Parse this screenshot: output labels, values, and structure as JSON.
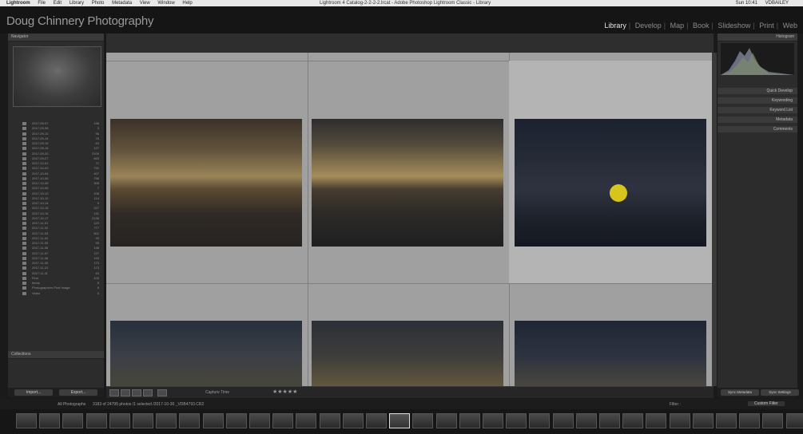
{
  "menubar": {
    "items": [
      "Lightroom",
      "File",
      "Edit",
      "Library",
      "Photo",
      "Metadata",
      "View",
      "Window",
      "Help"
    ],
    "window_title": "Lightroom 4 Catalog-2-2-2-2.lrcat - Adobe Photoshop Lightroom Classic - Library",
    "clock": "Sun 10:41",
    "user": "VDBAILEY"
  },
  "identity": {
    "plate": "Doug Chinnery Photography",
    "modules": [
      "Library",
      "Develop",
      "Map",
      "Book",
      "Slideshow",
      "Print",
      "Web"
    ],
    "active_module": "Library"
  },
  "left_panel": {
    "navigator_label": "Navigator",
    "folders": [
      {
        "name": "2017-09-07",
        "count": "198"
      },
      {
        "name": "2017-09-08",
        "count": "3"
      },
      {
        "name": "2017-09-10",
        "count": "96"
      },
      {
        "name": "2017-09-14",
        "count": "75"
      },
      {
        "name": "2017-09-15",
        "count": "63"
      },
      {
        "name": "2017-09-16",
        "count": "127"
      },
      {
        "name": "2017-09-20",
        "count": "2109"
      },
      {
        "name": "2017-09-27",
        "count": "663"
      },
      {
        "name": "2017-10-01",
        "count": "71"
      },
      {
        "name": "2017-10-03",
        "count": "791"
      },
      {
        "name": "2017-10-04",
        "count": "407"
      },
      {
        "name": "2017-10-05",
        "count": "796"
      },
      {
        "name": "2017-10-06",
        "count": "308"
      },
      {
        "name": "2017-10-08",
        "count": "7"
      },
      {
        "name": "2017-10-10",
        "count": "108"
      },
      {
        "name": "2017-10-12",
        "count": "114"
      },
      {
        "name": "2017-10-14",
        "count": "9"
      },
      {
        "name": "2017-10-15",
        "count": "227"
      },
      {
        "name": "2017-10-16",
        "count": "131"
      },
      {
        "name": "2017-10-17",
        "count": "2136"
      },
      {
        "name": "2017-11-01",
        "count": "123"
      },
      {
        "name": "2017-11-02",
        "count": "777"
      },
      {
        "name": "2017-11-03",
        "count": "501"
      },
      {
        "name": "2017-11-04",
        "count": "93"
      },
      {
        "name": "2017-11-05",
        "count": "95"
      },
      {
        "name": "2017-11-06",
        "count": "148"
      },
      {
        "name": "2017-11-07",
        "count": "127"
      },
      {
        "name": "2017-11-08",
        "count": "193"
      },
      {
        "name": "2017-11-09",
        "count": "173"
      },
      {
        "name": "2017-11-10",
        "count": "173"
      },
      {
        "name": "2017-11-11",
        "count": "63"
      },
      {
        "name": "Find",
        "count": "100"
      },
      {
        "name": "Items",
        "count": "8"
      },
      {
        "name": "Photographers Post Image",
        "count": "8"
      },
      {
        "name": "Video",
        "count": "6"
      }
    ],
    "collections_label": "Collections",
    "import_label": "Import...",
    "export_label": "Export..."
  },
  "toolbar": {
    "sort_label": "Capture Time"
  },
  "right_panel": {
    "histogram_label": "Histogram",
    "quick_develop": "Quick Develop",
    "keywording": "Keywording",
    "keyword_list": "Keyword List",
    "metadata": "Metadata",
    "comments": "Comments",
    "sync_metadata": "Sync Metadata",
    "sync_settings": "Sync Settings"
  },
  "filmstrip": {
    "source": "All Photographs",
    "status": "3183 of 24795 photos /1 selected /2017-10-30 _VDB4793.CR2",
    "filter_label": "Filter :",
    "filter_value": "Custom Filter"
  },
  "colors": {
    "accent_cursor": "#e6d21a",
    "grid_bg": "#a0a0a0"
  }
}
